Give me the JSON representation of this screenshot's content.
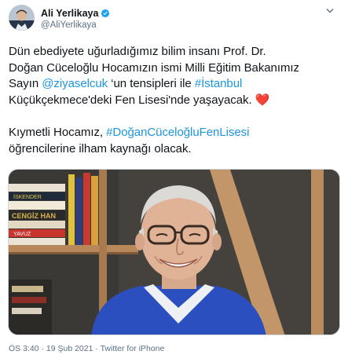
{
  "author": {
    "display_name": "Ali Yerlikaya",
    "handle": "@AliYerlikaya",
    "avatar_icon": "profile-avatar",
    "verified_icon": "verified-badge-icon",
    "menu_icon": "chevron-down-icon"
  },
  "tweet": {
    "line1": "Dün ebediyete uğurladığımız bilim insanı Prof. Dr.",
    "line2": "Doğan Cüceloğlu Hocamızın ismi Milli Eğitim Bakanımız",
    "line3_pre": "Sayın ",
    "mention": "@ziyaselcuk",
    "line3_mid": " ‘un tensipleri ile ",
    "hashtag_city": "#İstanbul",
    "line4": "Küçükçekmece'deki Fen Lisesi'nde yaşayacak.",
    "heart": "❤️",
    "line5": "Kıymetli Hocamız, ",
    "hashtag_school": "#DoğanCüceloğluFenLisesi",
    "line6": "öğrencilerine ilham kaynağı olacak."
  },
  "media": {
    "book_titles": [
      "CENGİZ HAN",
      "İSKENDER",
      "YAVUZ"
    ]
  },
  "meta": {
    "time": "ÖS 3:40",
    "separator": " · ",
    "date": "19 Şub 2021",
    "source": "Twitter for iPhone"
  },
  "colors": {
    "link": "#1b95e0",
    "secondary_text": "#5b7083",
    "verified": "#1da1f2",
    "heart": "#e0245e",
    "sweater": "#2c4fc0"
  }
}
